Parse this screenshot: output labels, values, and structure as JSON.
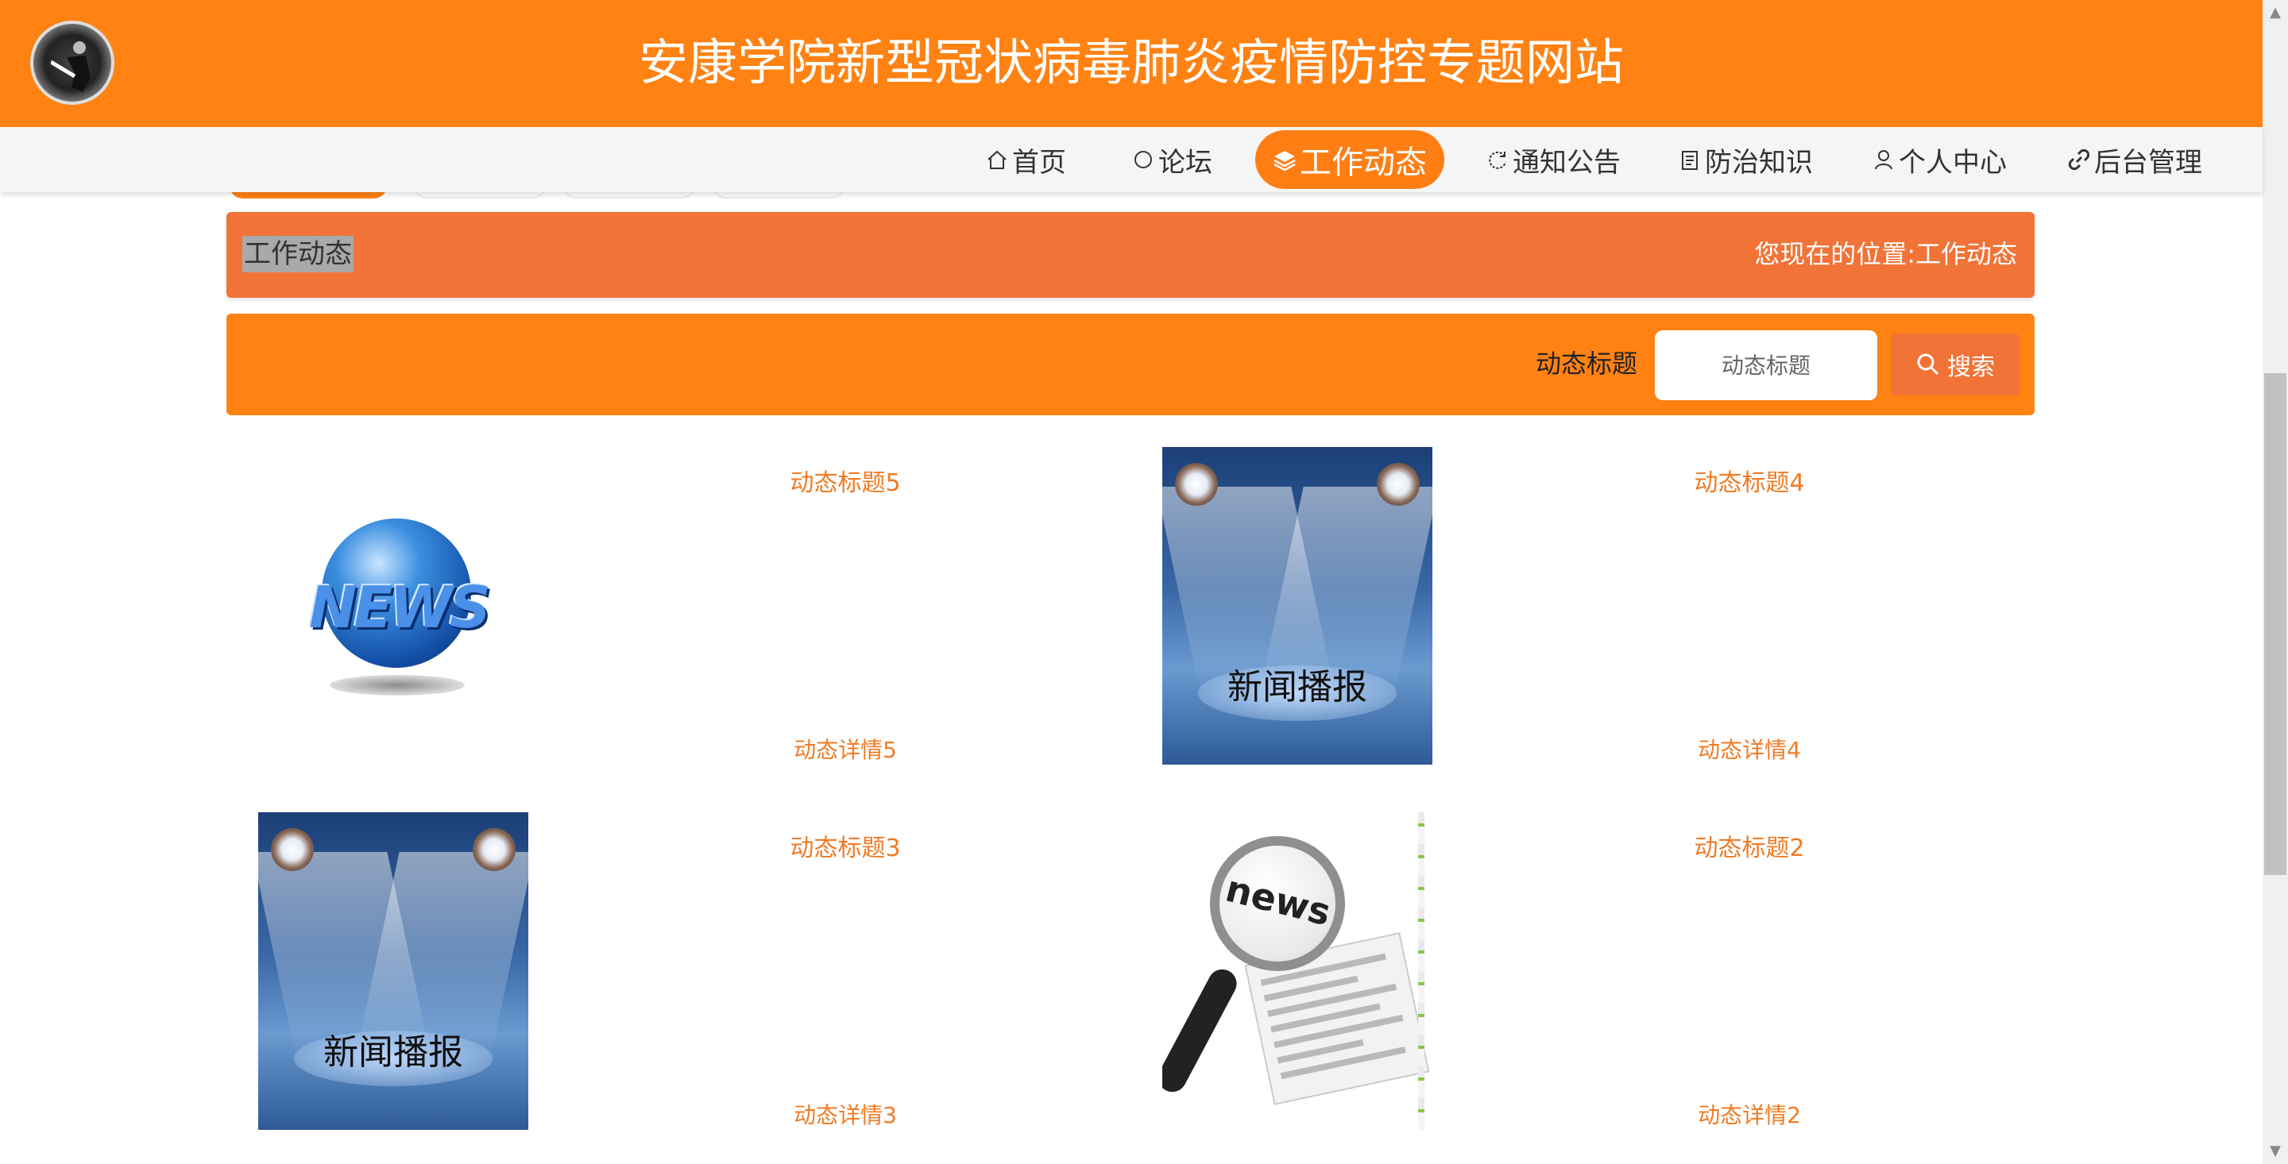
{
  "header": {
    "site_title": "安康学院新型冠状病毒肺炎疫情防控专题网站",
    "logo_icon": "school-logo-icon"
  },
  "nav": {
    "items": [
      {
        "label": "首页",
        "icon": "home-icon",
        "active": false
      },
      {
        "label": "论坛",
        "icon": "chat-bubble-icon",
        "active": false
      },
      {
        "label": "工作动态",
        "icon": "layers-icon",
        "active": true
      },
      {
        "label": "通知公告",
        "icon": "refresh-icon",
        "active": false
      },
      {
        "label": "防治知识",
        "icon": "clipboard-icon",
        "active": false
      },
      {
        "label": "个人中心",
        "icon": "user-icon",
        "active": false
      },
      {
        "label": "后台管理",
        "icon": "link-icon",
        "active": false
      }
    ],
    "active_color": "#ff7e13"
  },
  "breadcrumb": {
    "title": "工作动态",
    "location_prefix": "您现在的位置:",
    "location": "工作动态",
    "bar_color": "#f17337"
  },
  "search": {
    "label": "动态标题",
    "placeholder": "动态标题",
    "value": "",
    "button_label": "搜索",
    "button_icon": "search-icon",
    "bar_color": "#ff8213"
  },
  "cards": [
    {
      "title": "动态标题5",
      "detail": "动态详情5",
      "image": "news-globe-image"
    },
    {
      "title": "动态标题4",
      "detail": "动态详情4",
      "image": "news-broadcast-image",
      "image_caption": "新闻播报"
    },
    {
      "title": "动态标题3",
      "detail": "动态详情3",
      "image": "news-broadcast-image",
      "image_caption": "新闻播报"
    },
    {
      "title": "动态标题2",
      "detail": "动态详情2",
      "image": "news-magnifier-image"
    }
  ],
  "images": {
    "globe_text": "NEWS",
    "magnifier_text": "news"
  },
  "colors": {
    "header_bg": "#ff8213",
    "card_text": "#f07b24"
  }
}
